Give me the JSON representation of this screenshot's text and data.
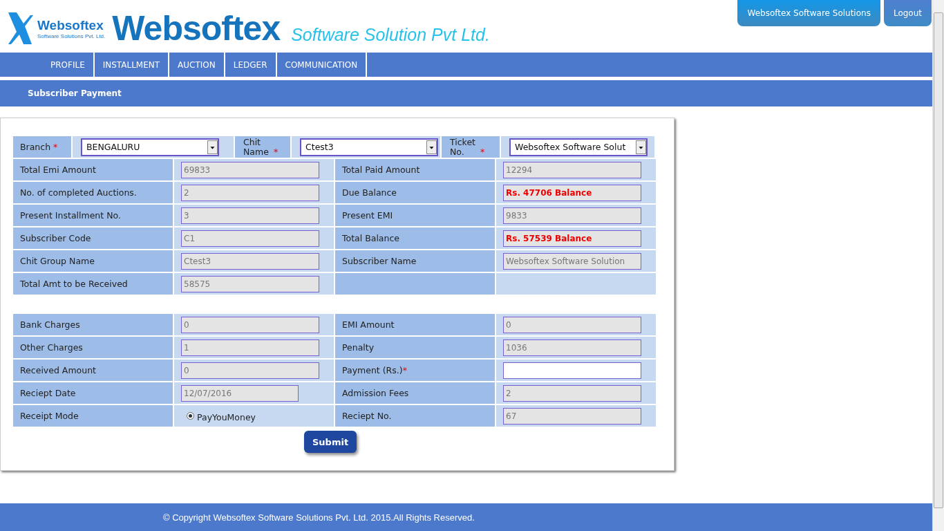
{
  "header": {
    "logo_name": "Websoftex",
    "logo_tagline": "Software Solutions Pvt. Ltd.",
    "brand": "Websoftex",
    "brand_sub": "Software Solution Pvt Ltd.",
    "user_button": "Websoftex Software Solutions",
    "logout_button": "Logout"
  },
  "nav": {
    "items": [
      "PROFILE",
      "INSTALLMENT",
      "AUCTION",
      "LEDGER",
      "COMMUNICATION"
    ]
  },
  "page_title": "Subscriber Payment",
  "selectors": [
    {
      "label": "Branch",
      "required_mark": "*",
      "value": "BENGALURU"
    },
    {
      "label": "Chit Name",
      "required_mark": "*",
      "value": "Ctest3"
    },
    {
      "label": "Ticket No.",
      "required_mark": "*",
      "value": "Websoftex Software Solut"
    }
  ],
  "summary_rows": [
    [
      {
        "label": "Total Emi Amount",
        "kind": "readonly",
        "value": "69833"
      },
      {
        "label": "Total Paid Amount",
        "kind": "readonly",
        "value": "12294"
      }
    ],
    [
      {
        "label": "No. of completed Auctions.",
        "kind": "readonly",
        "value": "2"
      },
      {
        "label": "Due Balance",
        "kind": "alert",
        "value": "Rs. 47706 Balance"
      }
    ],
    [
      {
        "label": "Present Installment No.",
        "kind": "readonly",
        "value": "3"
      },
      {
        "label": "Present EMI",
        "kind": "readonly",
        "value": "9833"
      }
    ],
    [
      {
        "label": "Subscriber Code",
        "kind": "readonly",
        "value": "C1"
      },
      {
        "label": "Total Balance",
        "kind": "alert",
        "value": "Rs. 57539 Balance"
      }
    ],
    [
      {
        "label": "Chit Group Name",
        "kind": "readonly",
        "value": "Ctest3"
      },
      {
        "label": "Subscriber Name",
        "kind": "readonly",
        "value": "Websoftex Software Solution"
      }
    ],
    [
      {
        "label": "Total Amt to be Received",
        "kind": "readonly",
        "value": "58575"
      },
      {
        "kind": "empty"
      }
    ]
  ],
  "payment_rows": [
    [
      {
        "label": "Bank Charges",
        "kind": "readonly",
        "value": "0"
      },
      {
        "label": "EMI Amount",
        "kind": "readonly",
        "value": "0"
      }
    ],
    [
      {
        "label": "Other Charges",
        "kind": "readonly",
        "value": "1"
      },
      {
        "label": "Penalty",
        "kind": "readonly",
        "value": "1036"
      }
    ],
    [
      {
        "label": "Received Amount",
        "kind": "readonly",
        "value": "0"
      },
      {
        "label": "Payment (Rs.)",
        "required_mark": "*",
        "kind": "editable"
      }
    ],
    [
      {
        "label": "Reciept Date",
        "kind": "date",
        "value": "12/07/2016"
      },
      {
        "label": "Admission Fees",
        "kind": "readonly",
        "value": "2"
      }
    ],
    [
      {
        "label": "Receipt Mode",
        "kind": "radio",
        "value": "PayYouMoney",
        "selected": true
      },
      {
        "label": "Reciept No.",
        "kind": "readonly",
        "value": "67"
      }
    ]
  ],
  "submit_button": "Submit",
  "footer": "© Copyright Websoftex Software Solutions Pvt. Ltd. 2015.All Rights Reserved."
}
